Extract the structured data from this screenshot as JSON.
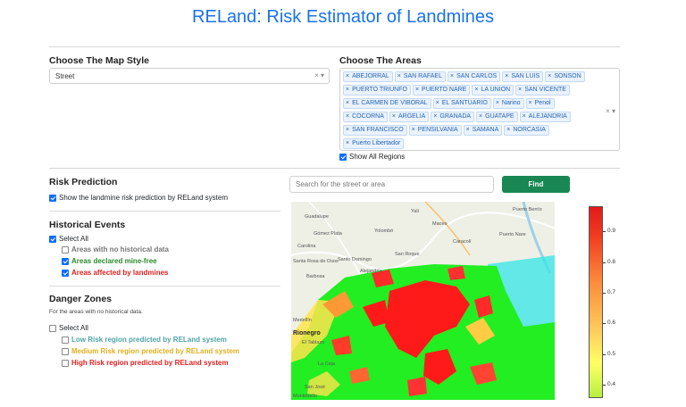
{
  "header": {
    "title": "RELand: Risk Estimator of Landmines"
  },
  "map_style": {
    "label": "Choose The Map Style",
    "selected": "Street",
    "clear_icon": "×",
    "caret_icon": "chevron-down"
  },
  "areas": {
    "label": "Choose The Areas",
    "tags": [
      "ABEJORRAL",
      "SAN RAFAEL",
      "SAN CARLOS",
      "SAN LUIS",
      "SONSON",
      "PUERTO TRIUNFO",
      "PUERTO NARE",
      "LA UNION",
      "SAN VICENTE",
      "EL CARMEN DE VIBORAL",
      "EL SANTUARIO",
      "Narino",
      "Penol",
      "COCORNA",
      "ARGELIA",
      "GRANADA",
      "GUATAPE",
      "ALEJANDRIA",
      "SAN FRANCISCO",
      "PENSILVANIA",
      "SAMANA",
      "NORCASIA",
      "Puerto Libertador"
    ],
    "show_all_label": "Show All Regions",
    "show_all_checked": true
  },
  "risk_prediction": {
    "label": "Risk Prediction",
    "checkbox_label": "Show the landmine risk prediction by RELand system",
    "checked": true
  },
  "historical_events": {
    "label": "Historical Events",
    "select_all_label": "Select All",
    "items": [
      {
        "label": "Areas with no historical data",
        "color": "#777777",
        "checked": false
      },
      {
        "label": "Areas declared mine-free",
        "color": "#2a8a2a",
        "checked": true
      },
      {
        "label": "Areas affected by landmines",
        "color": "#e02020",
        "checked": true
      }
    ]
  },
  "danger_zones": {
    "label": "Danger Zones",
    "note": "For the areas with no historical data.",
    "select_all_label": "Select All",
    "items": [
      {
        "label": "Low Risk region predicted by RELand system",
        "color": "#4fa3a5",
        "checked": false
      },
      {
        "label": "Medium Risk region predicted by RELand system",
        "color": "#e0b020",
        "checked": false
      },
      {
        "label": "High Risk region predicted by RELand system",
        "color": "#e02020",
        "checked": false
      }
    ]
  },
  "search": {
    "placeholder": "Search for the street or area",
    "button_label": "Find"
  },
  "map": {
    "places": [
      "Guadalupe",
      "Yalí",
      "Puerto Berrío",
      "Maceo",
      "Gómez Plata",
      "Yolombó",
      "Puerto Nare",
      "Caracolí",
      "Carolina",
      "Santo Domingo",
      "San Roque",
      "Santa Rosa de Osos",
      "Barbosa",
      "Alejandría",
      "Rionegro",
      "El Tablazo",
      "La Ceja",
      "San José",
      "Montebello",
      "Medellín"
    ],
    "colorbar_labels": [
      "0.9",
      "0.8",
      "0.7",
      "0.6",
      "0.5",
      "0.4"
    ]
  }
}
